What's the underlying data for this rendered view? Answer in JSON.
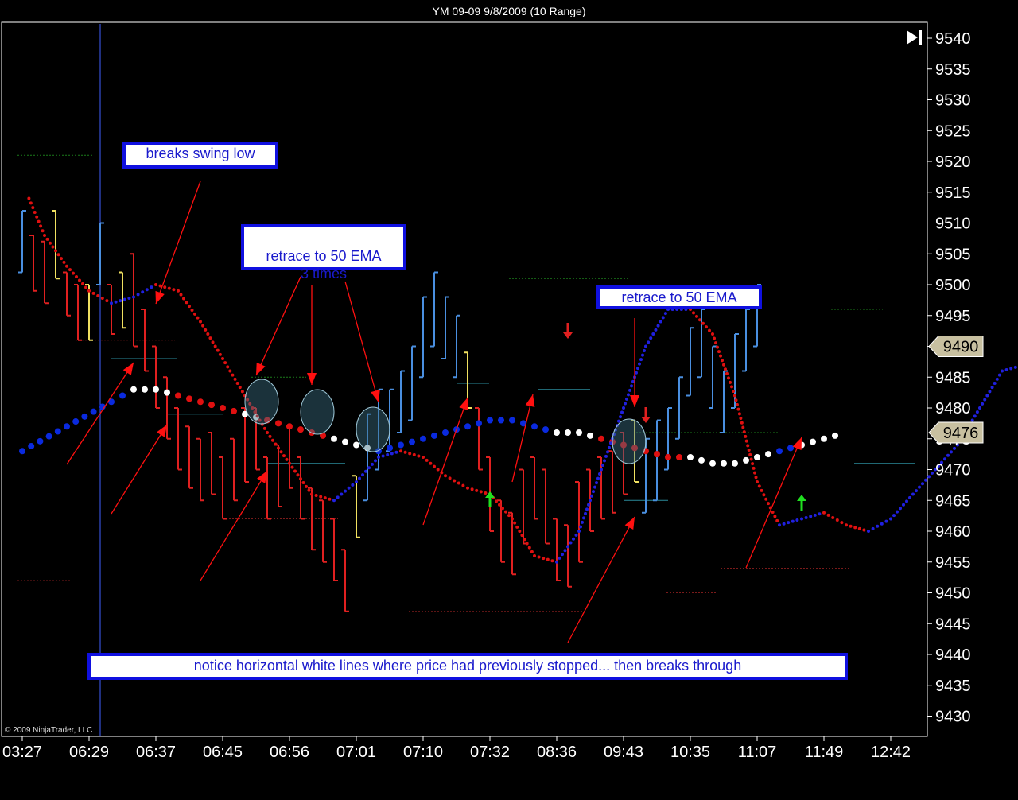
{
  "window": {
    "title": "YM 09-09  9/8/2009 (10 Range)"
  },
  "copyright": "© 2009 NinjaTrader, LLC",
  "icons": {
    "end_of_chart": "skip-to-end-icon"
  },
  "colors": {
    "background": "#000000",
    "up_bar": "#4a8fe0",
    "down_bar": "#e02020",
    "doji_bar": "#f0e060",
    "ema_fast_up": "#2020e0",
    "ema_fast_down": "#e01010",
    "ema_slow": "#0a2adf",
    "annotation_border": "#1010e0",
    "annotation_text": "#1a1acc",
    "arrow": "#ff1010",
    "price_tag": "#c8c0a0"
  },
  "annotations": [
    {
      "id": "breaks-swing-low",
      "text": "breaks swing low"
    },
    {
      "id": "retrace-3-times",
      "text": "retrace to 50 EMA\n3 times"
    },
    {
      "id": "retrace-once",
      "text": "retrace to 50 EMA"
    },
    {
      "id": "horizontal-lines",
      "text": "notice horizontal white lines where price had previously stopped... then breaks through"
    }
  ],
  "chart_data": {
    "type": "line",
    "title": "YM 09-09  9/8/2009 (10 Range)",
    "x_tick_labels": [
      "03:27",
      "06:29",
      "06:37",
      "06:45",
      "06:56",
      "07:01",
      "07:10",
      "07:32",
      "08:36",
      "09:43",
      "10:35",
      "11:07",
      "11:49",
      "12:42"
    ],
    "y_tick_labels": [
      9540,
      9535,
      9530,
      9525,
      9520,
      9515,
      9510,
      9505,
      9500,
      9495,
      9490,
      9485,
      9480,
      9475,
      9470,
      9465,
      9460,
      9455,
      9450,
      9445,
      9440,
      9435,
      9430
    ],
    "ylim": [
      9427,
      9543
    ],
    "price_tags": [
      {
        "label": "9490",
        "value": 9490
      },
      {
        "label": "9476",
        "value": 9476
      }
    ],
    "grid": false,
    "series": [
      {
        "name": "",
        "style": "dotted-fast",
        "points": [
          [
            0.3,
            9514
          ],
          [
            1,
            9508
          ],
          [
            2,
            9503
          ],
          [
            3,
            9499
          ],
          [
            4,
            9497
          ],
          [
            5,
            9498
          ],
          [
            6,
            9500
          ],
          [
            7,
            9499
          ],
          [
            8,
            9494
          ],
          [
            9,
            9488
          ],
          [
            10,
            9482
          ],
          [
            11,
            9476
          ],
          [
            12,
            9471
          ],
          [
            13,
            9466
          ],
          [
            14,
            9465
          ],
          [
            15,
            9468
          ],
          [
            16,
            9472
          ],
          [
            17,
            9473
          ],
          [
            18,
            9472
          ],
          [
            19,
            9469
          ],
          [
            20,
            9467
          ],
          [
            21,
            9466
          ],
          [
            22,
            9462
          ],
          [
            23,
            9456
          ],
          [
            24,
            9455
          ],
          [
            25,
            9460
          ],
          [
            26,
            9470
          ],
          [
            27,
            9480
          ],
          [
            28,
            9490
          ],
          [
            29,
            9496
          ],
          [
            30,
            9496
          ],
          [
            31,
            9492
          ],
          [
            32,
            9482
          ],
          [
            33,
            9468
          ],
          [
            34,
            9461
          ],
          [
            35,
            9462
          ],
          [
            36,
            9463
          ],
          [
            37,
            9461
          ],
          [
            38,
            9460
          ],
          [
            39,
            9462
          ],
          [
            40,
            9466
          ],
          [
            41,
            9470
          ],
          [
            42,
            9474
          ],
          [
            43,
            9480
          ],
          [
            44,
            9486
          ],
          [
            45,
            9487
          ],
          [
            46,
            9485
          ],
          [
            47,
            9488
          ],
          [
            48,
            9490
          ]
        ]
      },
      {
        "name": "",
        "style": "dotted-slow",
        "points": [
          [
            0,
            9473
          ],
          [
            2,
            9477
          ],
          [
            4,
            9481
          ],
          [
            5,
            9483
          ],
          [
            6,
            9483
          ],
          [
            7,
            9482
          ],
          [
            8,
            9481
          ],
          [
            9,
            9480
          ],
          [
            10,
            9479
          ],
          [
            11,
            9478
          ],
          [
            12,
            9477
          ],
          [
            13,
            9476
          ],
          [
            14,
            9475
          ],
          [
            15,
            9474
          ],
          [
            16,
            9473
          ],
          [
            17,
            9474
          ],
          [
            18,
            9475
          ],
          [
            19,
            9476
          ],
          [
            20,
            9477
          ],
          [
            21,
            9478
          ],
          [
            22,
            9478
          ],
          [
            23,
            9477
          ],
          [
            24,
            9476
          ],
          [
            25,
            9476
          ],
          [
            26,
            9475
          ],
          [
            27,
            9474
          ],
          [
            28,
            9473
          ],
          [
            29,
            9472
          ],
          [
            30,
            9472
          ],
          [
            31,
            9471
          ],
          [
            32,
            9471
          ],
          [
            33,
            9472
          ],
          [
            34,
            9473
          ],
          [
            35,
            9474
          ],
          [
            36,
            9475
          ],
          [
            37,
            9476
          ]
        ]
      }
    ],
    "bars": [
      {
        "x": 0,
        "low": 9502,
        "high": 9512,
        "dir": "up"
      },
      {
        "x": 0.5,
        "low": 9499,
        "high": 9508,
        "dir": "down"
      },
      {
        "x": 1,
        "low": 9497,
        "high": 9507,
        "dir": "down"
      },
      {
        "x": 1.5,
        "low": 9501,
        "high": 9512,
        "dir": "doji"
      },
      {
        "x": 2,
        "low": 9495,
        "high": 9502,
        "dir": "down"
      },
      {
        "x": 2.5,
        "low": 9491,
        "high": 9500,
        "dir": "down"
      },
      {
        "x": 3,
        "low": 9491,
        "high": 9500,
        "dir": "doji"
      },
      {
        "x": 3.5,
        "low": 9500,
        "high": 9510,
        "dir": "up"
      },
      {
        "x": 4,
        "low": 9492,
        "high": 9500,
        "dir": "down"
      },
      {
        "x": 4.5,
        "low": 9493,
        "high": 9502,
        "dir": "doji"
      },
      {
        "x": 5,
        "low": 9490,
        "high": 9505,
        "dir": "down"
      },
      {
        "x": 5.5,
        "low": 9486,
        "high": 9496,
        "dir": "down"
      },
      {
        "x": 6,
        "low": 9480,
        "high": 9490,
        "dir": "down"
      },
      {
        "x": 6.5,
        "low": 9475,
        "high": 9485,
        "dir": "down"
      },
      {
        "x": 7,
        "low": 9470,
        "high": 9480,
        "dir": "down"
      },
      {
        "x": 7.5,
        "low": 9467,
        "high": 9477,
        "dir": "down"
      },
      {
        "x": 8,
        "low": 9465,
        "high": 9475,
        "dir": "down"
      },
      {
        "x": 8.5,
        "low": 9466,
        "high": 9476,
        "dir": "down"
      },
      {
        "x": 9,
        "low": 9462,
        "high": 9472,
        "dir": "down"
      },
      {
        "x": 9.5,
        "low": 9465,
        "high": 9475,
        "dir": "down"
      },
      {
        "x": 10,
        "low": 9468,
        "high": 9480,
        "dir": "down"
      },
      {
        "x": 10.5,
        "low": 9470,
        "high": 9480,
        "dir": "down"
      },
      {
        "x": 11,
        "low": 9462,
        "high": 9472,
        "dir": "down"
      },
      {
        "x": 11.5,
        "low": 9464,
        "high": 9474,
        "dir": "down"
      },
      {
        "x": 12,
        "low": 9467,
        "high": 9477,
        "dir": "down"
      },
      {
        "x": 12.5,
        "low": 9462,
        "high": 9472,
        "dir": "down"
      },
      {
        "x": 13,
        "low": 9457,
        "high": 9467,
        "dir": "down"
      },
      {
        "x": 13.5,
        "low": 9455,
        "high": 9465,
        "dir": "down"
      },
      {
        "x": 14,
        "low": 9452,
        "high": 9462,
        "dir": "down"
      },
      {
        "x": 14.5,
        "low": 9447,
        "high": 9457,
        "dir": "down"
      },
      {
        "x": 15,
        "low": 9459,
        "high": 9469,
        "dir": "doji"
      },
      {
        "x": 15.5,
        "low": 9465,
        "high": 9479,
        "dir": "up"
      },
      {
        "x": 16,
        "low": 9470,
        "high": 9483,
        "dir": "up"
      },
      {
        "x": 16.5,
        "low": 9473,
        "high": 9483,
        "dir": "up"
      },
      {
        "x": 17,
        "low": 9476,
        "high": 9486,
        "dir": "up"
      },
      {
        "x": 17.5,
        "low": 9478,
        "high": 9490,
        "dir": "up"
      },
      {
        "x": 18,
        "low": 9485,
        "high": 9498,
        "dir": "up"
      },
      {
        "x": 18.5,
        "low": 9490,
        "high": 9502,
        "dir": "up"
      },
      {
        "x": 19,
        "low": 9488,
        "high": 9498,
        "dir": "up"
      },
      {
        "x": 19.5,
        "low": 9485,
        "high": 9495,
        "dir": "up"
      },
      {
        "x": 20,
        "low": 9480,
        "high": 9489,
        "dir": "doji"
      },
      {
        "x": 20.5,
        "low": 9470,
        "high": 9480,
        "dir": "down"
      },
      {
        "x": 21,
        "low": 9460,
        "high": 9472,
        "dir": "down"
      },
      {
        "x": 21.5,
        "low": 9455,
        "high": 9465,
        "dir": "down"
      },
      {
        "x": 22,
        "low": 9453,
        "high": 9463,
        "dir": "down"
      },
      {
        "x": 22.5,
        "low": 9458,
        "high": 9470,
        "dir": "down"
      },
      {
        "x": 23,
        "low": 9462,
        "high": 9472,
        "dir": "down"
      },
      {
        "x": 23.5,
        "low": 9458,
        "high": 9470,
        "dir": "down"
      },
      {
        "x": 24,
        "low": 9452,
        "high": 9462,
        "dir": "down"
      },
      {
        "x": 24.5,
        "low": 9451,
        "high": 9461,
        "dir": "down"
      },
      {
        "x": 25,
        "low": 9455,
        "high": 9468,
        "dir": "down"
      },
      {
        "x": 25.5,
        "low": 9460,
        "high": 9470,
        "dir": "down"
      },
      {
        "x": 26,
        "low": 9462,
        "high": 9472,
        "dir": "down"
      },
      {
        "x": 26.5,
        "low": 9463,
        "high": 9473,
        "dir": "down"
      },
      {
        "x": 27,
        "low": 9466,
        "high": 9476,
        "dir": "down"
      },
      {
        "x": 27.5,
        "low": 9468,
        "high": 9478,
        "dir": "doji"
      },
      {
        "x": 28,
        "low": 9463,
        "high": 9475,
        "dir": "up"
      },
      {
        "x": 28.5,
        "low": 9465,
        "high": 9478,
        "dir": "up"
      },
      {
        "x": 29,
        "low": 9470,
        "high": 9480,
        "dir": "up"
      },
      {
        "x": 29.5,
        "low": 9475,
        "high": 9485,
        "dir": "up"
      },
      {
        "x": 30,
        "low": 9482,
        "high": 9493,
        "dir": "up"
      },
      {
        "x": 30.5,
        "low": 9485,
        "high": 9496,
        "dir": "up"
      },
      {
        "x": 31,
        "low": 9480,
        "high": 9490,
        "dir": "up"
      },
      {
        "x": 31.5,
        "low": 9476,
        "high": 9486,
        "dir": "up"
      },
      {
        "x": 32,
        "low": 9480,
        "high": 9492,
        "dir": "up"
      },
      {
        "x": 32.5,
        "low": 9486,
        "high": 9496,
        "dir": "up"
      },
      {
        "x": 33,
        "low": 9490,
        "high": 9500,
        "dir": "up"
      }
    ]
  }
}
